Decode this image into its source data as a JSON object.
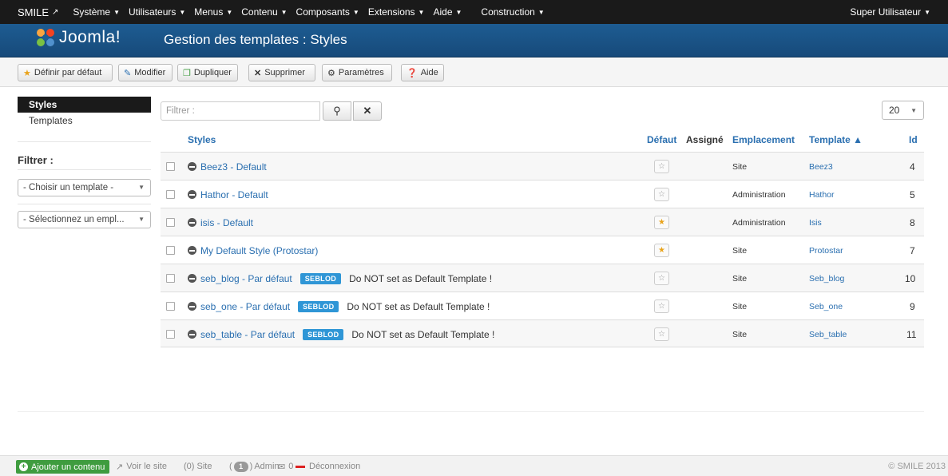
{
  "topbar": {
    "brand": "SMILE",
    "brand_icon": "external-link-icon",
    "menus": [
      "Système",
      "Utilisateurs",
      "Menus",
      "Contenu",
      "Composants",
      "Extensions",
      "Aide",
      "Construction"
    ],
    "user": "Super Utilisateur"
  },
  "header": {
    "logo_text": "Joomla!",
    "title": "Gestion des templates : Styles"
  },
  "toolbar": {
    "default_label": "Définir par défaut",
    "edit_label": "Modifier",
    "duplicate_label": "Dupliquer",
    "delete_label": "Supprimer",
    "options_label": "Paramètres",
    "help_label": "Aide"
  },
  "sidebar": {
    "items": [
      {
        "label": "Styles",
        "active": true
      },
      {
        "label": "Templates",
        "active": false
      }
    ],
    "filter_title": "Filtrer :",
    "template_select": "- Choisir un template -",
    "position_select": "- Sélectionnez un empl..."
  },
  "filter": {
    "placeholder": "Filtrer :",
    "limit": "20"
  },
  "table": {
    "headers": {
      "styles": "Styles",
      "default": "Défaut",
      "assigned": "Assigné",
      "location": "Emplacement",
      "template": "Template ▲",
      "id": "Id"
    },
    "rows": [
      {
        "name": "Beez3 - Default",
        "badge": "",
        "note": "",
        "default": false,
        "location": "Site",
        "template": "Beez3",
        "id": "4"
      },
      {
        "name": "Hathor - Default",
        "badge": "",
        "note": "",
        "default": false,
        "location": "Administration",
        "template": "Hathor",
        "id": "5"
      },
      {
        "name": "isis - Default",
        "badge": "",
        "note": "",
        "default": true,
        "location": "Administration",
        "template": "Isis",
        "id": "8"
      },
      {
        "name": "My Default Style (Protostar)",
        "badge": "",
        "note": "",
        "default": true,
        "location": "Site",
        "template": "Protostar",
        "id": "7"
      },
      {
        "name": "seb_blog - Par défaut",
        "badge": "SEBLOD",
        "note": "Do NOT set as Default Template !",
        "default": false,
        "location": "Site",
        "template": "Seb_blog",
        "id": "10"
      },
      {
        "name": "seb_one - Par défaut",
        "badge": "SEBLOD",
        "note": "Do NOT set as Default Template !",
        "default": false,
        "location": "Site",
        "template": "Seb_one",
        "id": "9"
      },
      {
        "name": "seb_table - Par défaut",
        "badge": "SEBLOD",
        "note": "Do NOT set as Default Template !",
        "default": false,
        "location": "Site",
        "template": "Seb_table",
        "id": "11"
      }
    ]
  },
  "statusbar": {
    "add_content": "Ajouter un contenu",
    "view_site": "Voir le site",
    "site_count": "(0) Site",
    "admin_count": "1",
    "admin_label": "Admin",
    "messages": "0",
    "logout": "Déconnexion",
    "copyright": "© SMILE 2013"
  },
  "colors": {
    "topbar": "#1a1a1a",
    "header": "#1d5c92",
    "link": "#2a6fb0",
    "badge": "#2f96d6",
    "star": "#e9a31b",
    "add_button": "#3f9c3f"
  }
}
